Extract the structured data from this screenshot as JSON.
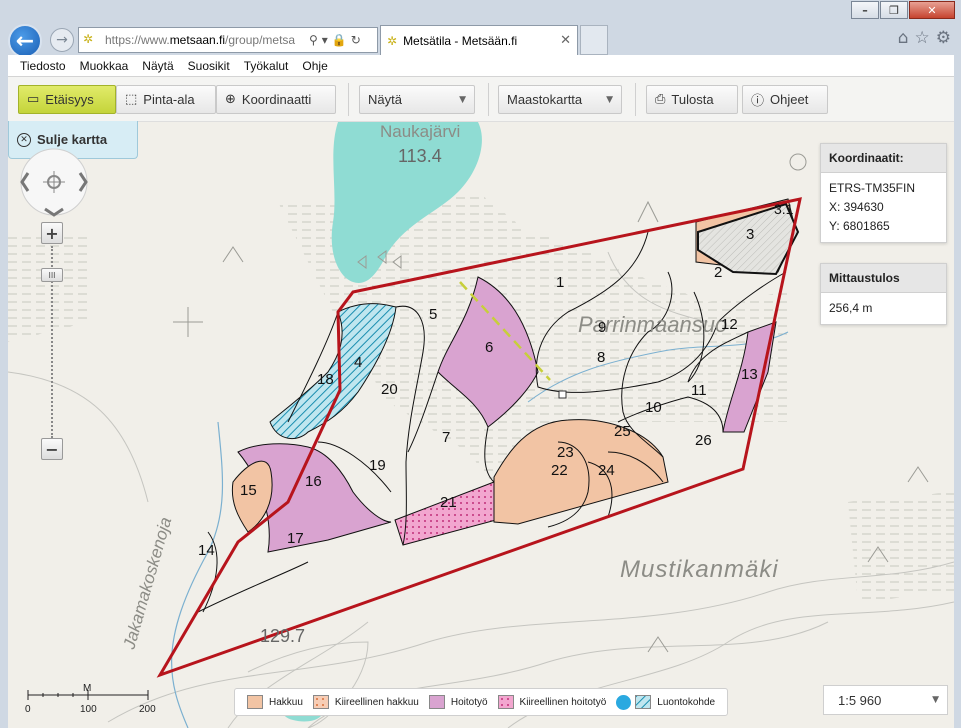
{
  "browser": {
    "url_prefix": "https://www.",
    "url_domain": "metsaan.fi",
    "url_path": "/group/metsa",
    "tab_title": "Metsätila - Metsään.fi",
    "window_buttons": [
      "–",
      "❐",
      "✕"
    ]
  },
  "menu": [
    "Tiedosto",
    "Muokkaa",
    "Näytä",
    "Suosikit",
    "Työkalut",
    "Ohje"
  ],
  "toolbar": {
    "distance": "Etäisyys",
    "area": "Pinta-ala",
    "coordinates": "Koordinaatti",
    "show": "Näytä",
    "basemap": "Maastokartta",
    "print": "Tulosta",
    "help": "Ohjeet"
  },
  "close_map": "Sulje kartta",
  "coords_panel": {
    "title": "Koordinaatit:",
    "system": "ETRS-TM35FIN",
    "x": "X: 394630",
    "y": "Y: 6801865"
  },
  "measure_panel": {
    "title": "Mittaustulos",
    "value": "256,4 m"
  },
  "legend": [
    {
      "label": "Hakkuu",
      "color": "#f2c4a4"
    },
    {
      "label": "Kiireellinen hakkuu",
      "color": "#f7cdb5"
    },
    {
      "label": "Hoitotyö",
      "color": "#d9a3d0"
    },
    {
      "label": "Kiireellinen hoitotyö",
      "color": "#f2a6cf"
    },
    {
      "label": "Luontokohde",
      "color": "#bfe6ef"
    }
  ],
  "scale": "1:5 960",
  "scalebar": {
    "unit": "M",
    "ticks": [
      "0",
      "100",
      "200"
    ]
  },
  "map": {
    "places": [
      "Naukajärvi",
      "113.4",
      "Parrinmaansuo",
      "Mustikanmäki",
      "Jakamakoskenoja",
      "129.7"
    ],
    "compartments": [
      "1",
      "2",
      "3",
      "3.1",
      "4",
      "5",
      "6",
      "7",
      "8",
      "9",
      "10",
      "11",
      "12",
      "13",
      "14",
      "15",
      "16",
      "17",
      "18",
      "19",
      "20",
      "21",
      "22",
      "23",
      "24",
      "25",
      "26"
    ]
  }
}
